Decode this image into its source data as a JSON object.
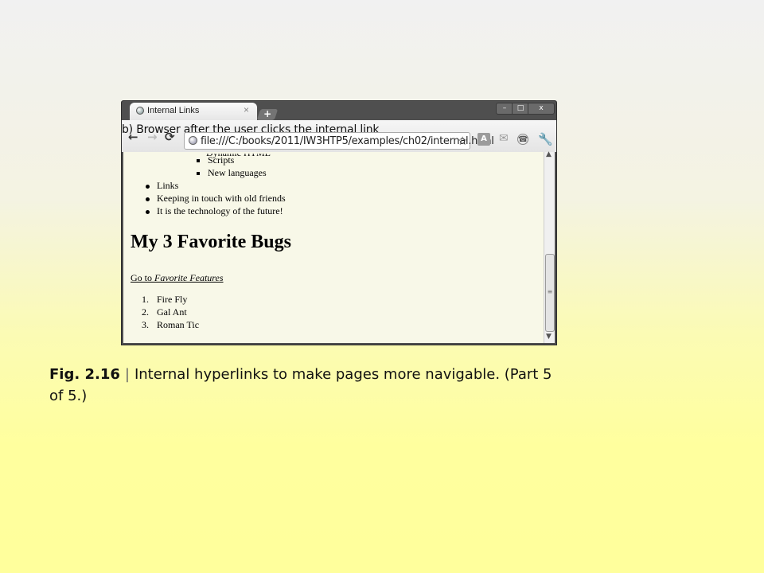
{
  "browser": {
    "tab_title": "Internal Links",
    "tab_close": "×",
    "new_tab": "+",
    "window_buttons": {
      "minimize": "–",
      "maximize": "□",
      "close": "x"
    },
    "nav": {
      "back": "←",
      "forward": "→",
      "reload": "⟳"
    },
    "url": "file:///C:/books/2011/IW3HTP5/examples/ch02/internal.html",
    "bookmark_star": "☆",
    "translate_icon": "A",
    "mail_icon": "✉",
    "extension_icon": "☎",
    "wrench_icon": "🔧"
  },
  "annotation": "b) Browser after the user clicks the internal link",
  "page": {
    "cut_off_item": "Dynamic HTML",
    "nested_items": [
      "Scripts",
      "New languages"
    ],
    "bullet_items": [
      "Links",
      "Keeping in touch with old friends",
      "It is the technology of the future!"
    ],
    "heading": "My 3 Favorite Bugs",
    "goto_prefix": "Go to",
    "goto_link": "Favorite Features",
    "ordered_items": [
      {
        "num": "1.",
        "text": "Fire Fly"
      },
      {
        "num": "2.",
        "text": "Gal Ant"
      },
      {
        "num": "3.",
        "text": "Roman Tic"
      }
    ]
  },
  "scrollbar": {
    "up": "▲",
    "down": "▼",
    "grip": "≡"
  },
  "caption": {
    "fig_label": "Fig. 2.16",
    "separator": "|",
    "text": "Internal hyperlinks to make pages more navigable. (Part 5 of 5.)"
  }
}
